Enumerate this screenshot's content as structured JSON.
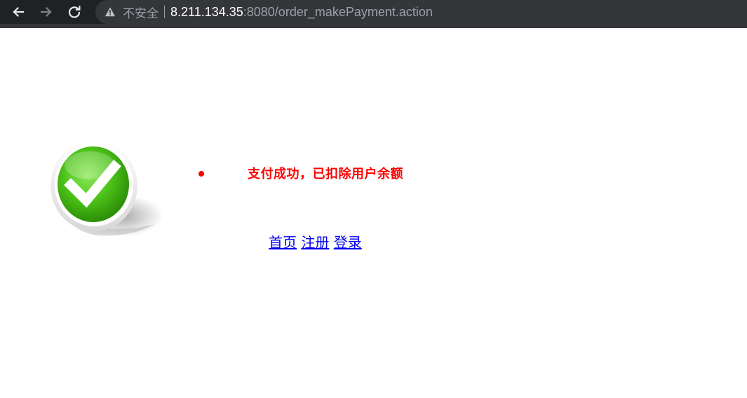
{
  "browser": {
    "security_label": "不安全",
    "url_host": "8.211.134.35",
    "url_rest": ":8080/order_makePayment.action"
  },
  "icons": {
    "back": "arrow-left-icon",
    "forward": "arrow-right-icon",
    "reload": "reload-icon",
    "security": "warning-triangle-icon",
    "success": "green-checkmark-icon"
  },
  "colors": {
    "message": "#ff0000",
    "link": "#0000ee",
    "check_green": "#4cc218"
  },
  "page": {
    "message": "支付成功，已扣除用户余额",
    "links": [
      {
        "label": "首页"
      },
      {
        "label": "注册"
      },
      {
        "label": "登录"
      }
    ]
  }
}
